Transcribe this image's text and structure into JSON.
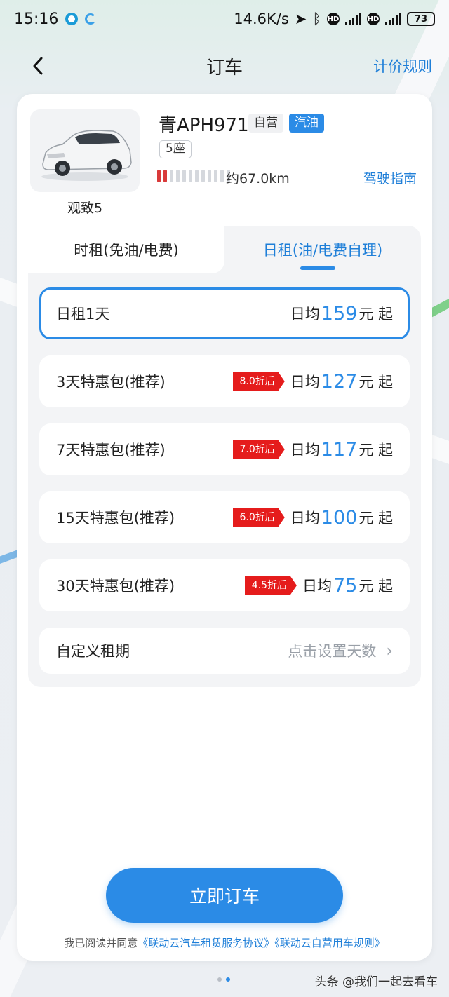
{
  "status_bar": {
    "time": "15:16",
    "net_speed": "14.6K/s",
    "network_1": "4G",
    "network_2": "4G",
    "hd": "HD",
    "battery": "73"
  },
  "nav": {
    "title": "订车",
    "right_link": "计价规则",
    "back_icon": "chevron-left-icon"
  },
  "vehicle": {
    "model_name": "观致5",
    "plate": "青APH971",
    "tag_self": "自营",
    "tag_fuel": "汽油",
    "seats": "5座",
    "fuel_level_segments_on": 2,
    "fuel_level_segments_total": 12,
    "range": "约67.0km",
    "guide_link": "驾驶指南"
  },
  "tabs": [
    {
      "label": "时租(免油/电费)",
      "active": false
    },
    {
      "label": "日租(油/电费自理)",
      "active": true
    }
  ],
  "plans": [
    {
      "label": "日租1天",
      "discount": "",
      "prefix": "日均",
      "price": "159",
      "suffix": "元 起",
      "selected": true
    },
    {
      "label": "3天特惠包(推荐)",
      "discount": "8.0折后",
      "prefix": "日均",
      "price": "127",
      "suffix": "元 起",
      "selected": false
    },
    {
      "label": "7天特惠包(推荐)",
      "discount": "7.0折后",
      "prefix": "日均",
      "price": "117",
      "suffix": "元 起",
      "selected": false
    },
    {
      "label": "15天特惠包(推荐)",
      "discount": "6.0折后",
      "prefix": "日均",
      "price": "100",
      "suffix": "元 起",
      "selected": false
    },
    {
      "label": "30天特惠包(推荐)",
      "discount": "4.5折后",
      "prefix": "日均",
      "price": "75",
      "suffix": "元 起",
      "selected": false
    }
  ],
  "custom_plan": {
    "label": "自定义租期",
    "hint": "点击设置天数"
  },
  "actions": {
    "book_button": "立即订车"
  },
  "agreement": {
    "prefix": "我已阅读并同意",
    "link1": "《联动云汽车租赁服务协议》",
    "link2": "《联动云自营用车规则》"
  },
  "watermark": "头条 @我们一起去看车",
  "colors": {
    "accent": "#2b8be6",
    "discount_red": "#e51c1c",
    "fuel_red": "#d93a3a"
  }
}
